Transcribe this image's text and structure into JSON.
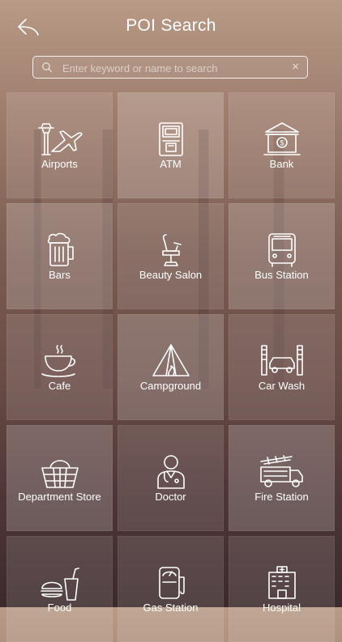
{
  "header": {
    "title": "POI Search"
  },
  "search": {
    "placeholder": "Enter keyword or name to search",
    "clear_symbol": "×"
  },
  "categories": [
    {
      "label": "Airports",
      "icon": "airport-icon"
    },
    {
      "label": "ATM",
      "icon": "atm-icon"
    },
    {
      "label": "Bank",
      "icon": "bank-icon"
    },
    {
      "label": "Bars",
      "icon": "beer-mug-icon"
    },
    {
      "label": "Beauty Salon",
      "icon": "salon-chair-icon"
    },
    {
      "label": "Bus Station",
      "icon": "bus-icon"
    },
    {
      "label": "Cafe",
      "icon": "coffee-cup-icon"
    },
    {
      "label": "Campground",
      "icon": "tent-icon"
    },
    {
      "label": "Car Wash",
      "icon": "car-wash-icon"
    },
    {
      "label": "Department Store",
      "icon": "shopping-basket-icon"
    },
    {
      "label": "Doctor",
      "icon": "doctor-icon"
    },
    {
      "label": "Fire Station",
      "icon": "fire-truck-icon"
    },
    {
      "label": "Food",
      "icon": "food-icon"
    },
    {
      "label": "Gas Station",
      "icon": "gas-pump-icon"
    },
    {
      "label": "Hospital",
      "icon": "hospital-icon"
    }
  ]
}
